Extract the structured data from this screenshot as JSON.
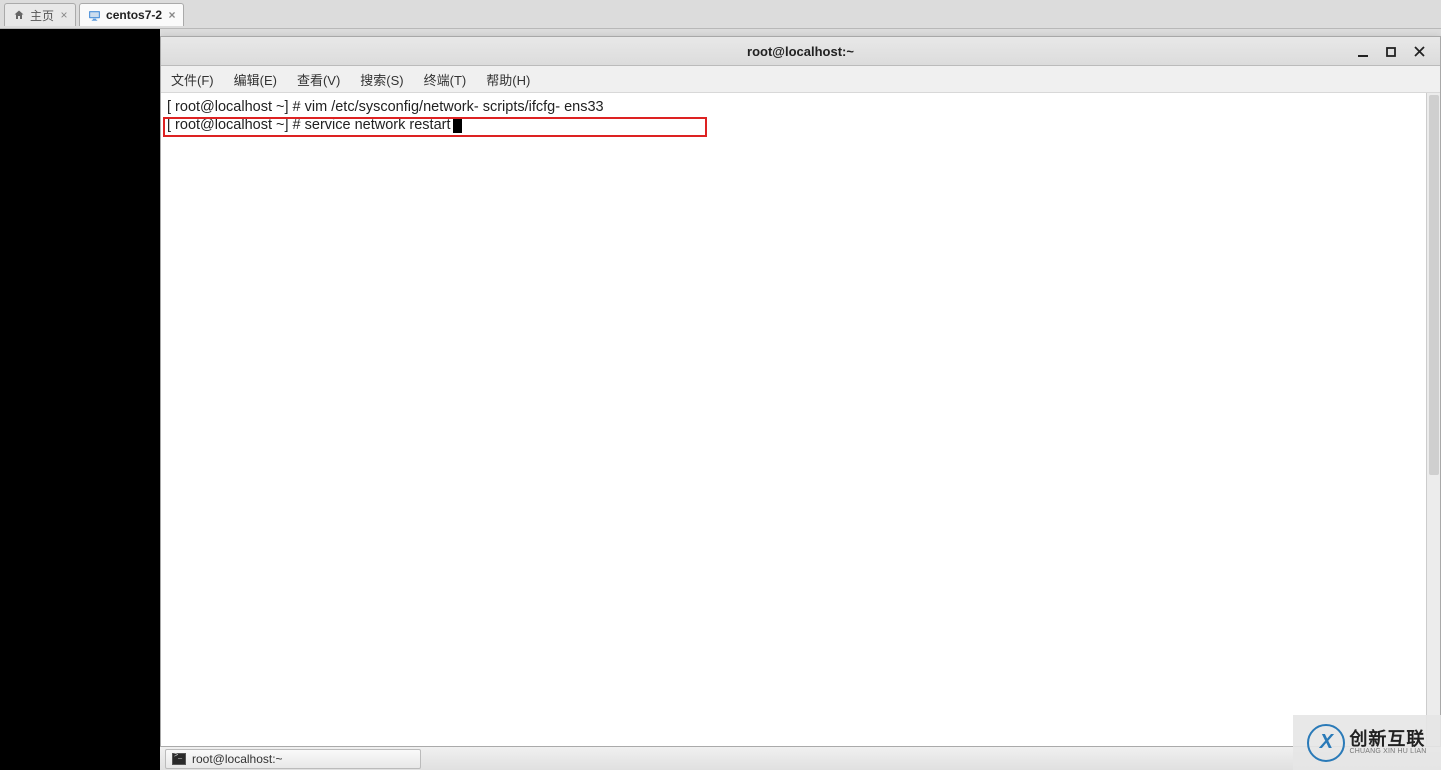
{
  "tabs": {
    "home": {
      "label": "主页"
    },
    "vm": {
      "label": "centos7-2"
    }
  },
  "window": {
    "title": "root@localhost:~"
  },
  "menus": {
    "file": "文件(F)",
    "edit": "编辑(E)",
    "view": "查看(V)",
    "search": "搜索(S)",
    "terminal": "终端(T)",
    "help": "帮助(H)"
  },
  "terminal": {
    "line1": "[ root@localhost ~] # vim /etc/sysconfig/network- scripts/ifcfg- ens33",
    "line2": "[ root@localhost ~] # service network restart"
  },
  "taskbar": {
    "app1": "root@localhost:~"
  },
  "watermark": {
    "cn": "创新互联",
    "en": "CHUANG XIN HU LIAN"
  }
}
